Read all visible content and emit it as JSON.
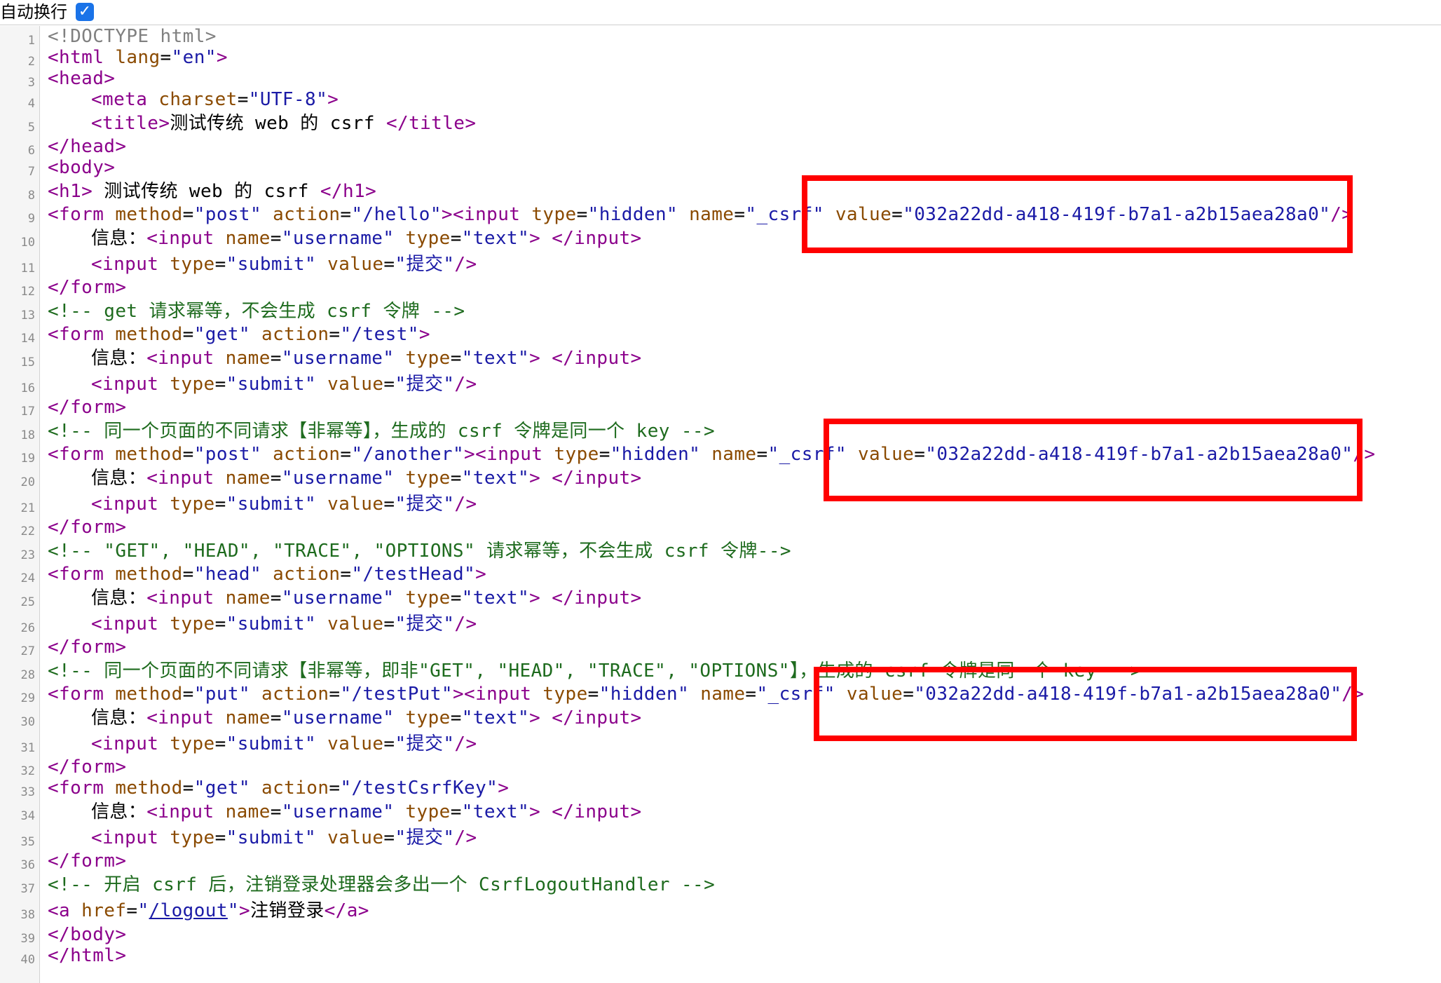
{
  "toolbar": {
    "wrap_label": "自动换行",
    "wrap_checked": true
  },
  "gutter": {
    "line_numbers": [
      "1",
      "2",
      "3",
      "4",
      "5",
      "6",
      "7",
      "8",
      "9",
      "10",
      "11",
      "12",
      "13",
      "14",
      "15",
      "16",
      "17",
      "18",
      "19",
      "20",
      "21",
      "22",
      "23",
      "24",
      "25",
      "26",
      "27",
      "28",
      "29",
      "30",
      "31",
      "32",
      "33",
      "34",
      "35",
      "36",
      "37",
      "38",
      "39",
      "40"
    ]
  },
  "code": {
    "l1": {
      "doctype": "<!DOCTYPE html>"
    },
    "l2": {
      "open": "<html ",
      "attr": "lang",
      "eq": "=",
      "val": "\"en\"",
      "close": ">"
    },
    "l3": {
      "tag": "<head>"
    },
    "l4": {
      "open": "<meta ",
      "attr": "charset",
      "eq": "=",
      "val": "\"UTF-8\"",
      "close": ">"
    },
    "l5": {
      "open": "<title>",
      "text": "测试传统 web 的 csrf ",
      "close": "</title>"
    },
    "l6": {
      "tag": "</head>"
    },
    "l7": {
      "tag": "<body>"
    },
    "l8": {
      "open": "<h1>",
      "text": " 测试传统 web 的 csrf ",
      "close": "</h1>"
    },
    "l9": {
      "open": "<form ",
      "a1": "method",
      "v1": "\"post\"",
      "a2": " action",
      "v2": "\"/hello\"",
      "t2": "><input ",
      "a3": "type",
      "v3": "\"hidden\"",
      "a4": " name",
      "v4": "\"_csrf\"",
      "a5": " value",
      "v5": "\"032a22dd-a418-419f-b7a1-a2b15aea28a0\"",
      "close": "/>"
    },
    "l10": {
      "label": "信息：",
      "open": "<input ",
      "a1": "name",
      "v1": "\"username\"",
      "a2": " type",
      "v2": "\"text\"",
      "mid": "> ",
      "close": "</input>"
    },
    "l11": {
      "open": "<input ",
      "a1": "type",
      "v1": "\"submit\"",
      "a2": " value",
      "v2": "\"提交\"",
      "close": "/>"
    },
    "l12": {
      "tag": "</form>"
    },
    "l13": {
      "comment": "<!-- get 请求幂等，不会生成 csrf 令牌 -->"
    },
    "l14": {
      "open": "<form ",
      "a1": "method",
      "v1": "\"get\"",
      "a2": " action",
      "v2": "\"/test\"",
      "close": ">"
    },
    "l15": {
      "label": "信息：",
      "open": "<input ",
      "a1": "name",
      "v1": "\"username\"",
      "a2": " type",
      "v2": "\"text\"",
      "mid": "> ",
      "close": "</input>"
    },
    "l16": {
      "open": "<input ",
      "a1": "type",
      "v1": "\"submit\"",
      "a2": " value",
      "v2": "\"提交\"",
      "close": "/>"
    },
    "l17": {
      "tag": "</form>"
    },
    "l18": {
      "comment": "<!-- 同一个页面的不同请求【非幂等】，生成的 csrf 令牌是同一个 key -->"
    },
    "l19": {
      "open": "<form ",
      "a1": "method",
      "v1": "\"post\"",
      "a2": " action",
      "v2": "\"/another\"",
      "t2": "><input ",
      "a3": "type",
      "v3": "\"hidden\"",
      "a4": " name",
      "v4": "\"_csrf\"",
      "a5": " value",
      "v5": "\"032a22dd-a418-419f-b7a1-a2b15aea28a0\"",
      "close": "/>"
    },
    "l20": {
      "label": "信息：",
      "open": "<input ",
      "a1": "name",
      "v1": "\"username\"",
      "a2": " type",
      "v2": "\"text\"",
      "mid": "> ",
      "close": "</input>"
    },
    "l21": {
      "open": "<input ",
      "a1": "type",
      "v1": "\"submit\"",
      "a2": " value",
      "v2": "\"提交\"",
      "close": "/>"
    },
    "l22": {
      "tag": "</form>"
    },
    "l23": {
      "comment": "<!-- \"GET\", \"HEAD\", \"TRACE\", \"OPTIONS\" 请求幂等，不会生成 csrf 令牌-->"
    },
    "l24": {
      "open": "<form ",
      "a1": "method",
      "v1": "\"head\"",
      "a2": " action",
      "v2": "\"/testHead\"",
      "close": ">"
    },
    "l25": {
      "label": "信息：",
      "open": "<input ",
      "a1": "name",
      "v1": "\"username\"",
      "a2": " type",
      "v2": "\"text\"",
      "mid": "> ",
      "close": "</input>"
    },
    "l26": {
      "open": "<input ",
      "a1": "type",
      "v1": "\"submit\"",
      "a2": " value",
      "v2": "\"提交\"",
      "close": "/>"
    },
    "l27": {
      "tag": "</form>"
    },
    "l28": {
      "comment": "<!-- 同一个页面的不同请求【非幂等，即非\"GET\", \"HEAD\", \"TRACE\", \"OPTIONS\"】，生成的 csrf 令牌是同一个 key -->"
    },
    "l29": {
      "open": "<form ",
      "a1": "method",
      "v1": "\"put\"",
      "a2": " action",
      "v2": "\"/testPut\"",
      "t2": "><input ",
      "a3": "type",
      "v3": "\"hidden\"",
      "a4": " name",
      "v4": "\"_csrf\"",
      "a5": " value",
      "v5": "\"032a22dd-a418-419f-b7a1-a2b15aea28a0\"",
      "close": "/>"
    },
    "l30": {
      "label": "信息：",
      "open": "<input ",
      "a1": "name",
      "v1": "\"username\"",
      "a2": " type",
      "v2": "\"text\"",
      "mid": "> ",
      "close": "</input>"
    },
    "l31": {
      "open": "<input ",
      "a1": "type",
      "v1": "\"submit\"",
      "a2": " value",
      "v2": "\"提交\"",
      "close": "/>"
    },
    "l32": {
      "tag": "</form>"
    },
    "l33": {
      "open": "<form ",
      "a1": "method",
      "v1": "\"get\"",
      "a2": " action",
      "v2": "\"/testCsrfKey\"",
      "close": ">"
    },
    "l34": {
      "label": "信息：",
      "open": "<input ",
      "a1": "name",
      "v1": "\"username\"",
      "a2": " type",
      "v2": "\"text\"",
      "mid": "> ",
      "close": "</input>"
    },
    "l35": {
      "open": "<input ",
      "a1": "type",
      "v1": "\"submit\"",
      "a2": " value",
      "v2": "\"提交\"",
      "close": "/>"
    },
    "l36": {
      "tag": "</form>"
    },
    "l37": {
      "comment": "<!-- 开启 csrf 后，注销登录处理器会多出一个 CsrfLogoutHandler -->"
    },
    "l38": {
      "open": "<a ",
      "attr": "href",
      "q1": "\"",
      "link": "/logout",
      "q2": "\"",
      "gt": ">",
      "text": "注销登录",
      "close": "</a>"
    },
    "l39": {
      "tag": "</body>"
    },
    "l40": {
      "tag": "</html>"
    }
  },
  "colors": {
    "tag": "#8b008b",
    "attr": "#8a4a00",
    "string": "#1a1aa6",
    "comment": "#1e6b1e",
    "highlight": "#ff0000"
  }
}
